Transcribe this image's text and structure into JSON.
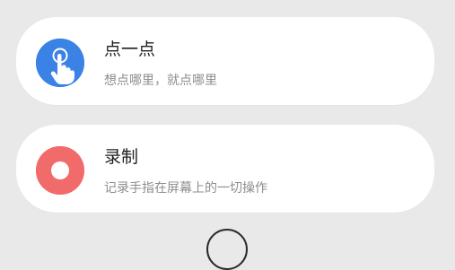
{
  "cards": [
    {
      "title": "点一点",
      "subtitle": "想点哪里，就点哪里",
      "icon": "tap-hand-icon",
      "icon_color": "#3b82e6"
    },
    {
      "title": "录制",
      "subtitle": "记录手指在屏幕上的一切操作",
      "icon": "record-icon",
      "icon_color": "#f26b6b"
    }
  ],
  "bottom_control": {
    "icon": "circle-button-icon"
  }
}
